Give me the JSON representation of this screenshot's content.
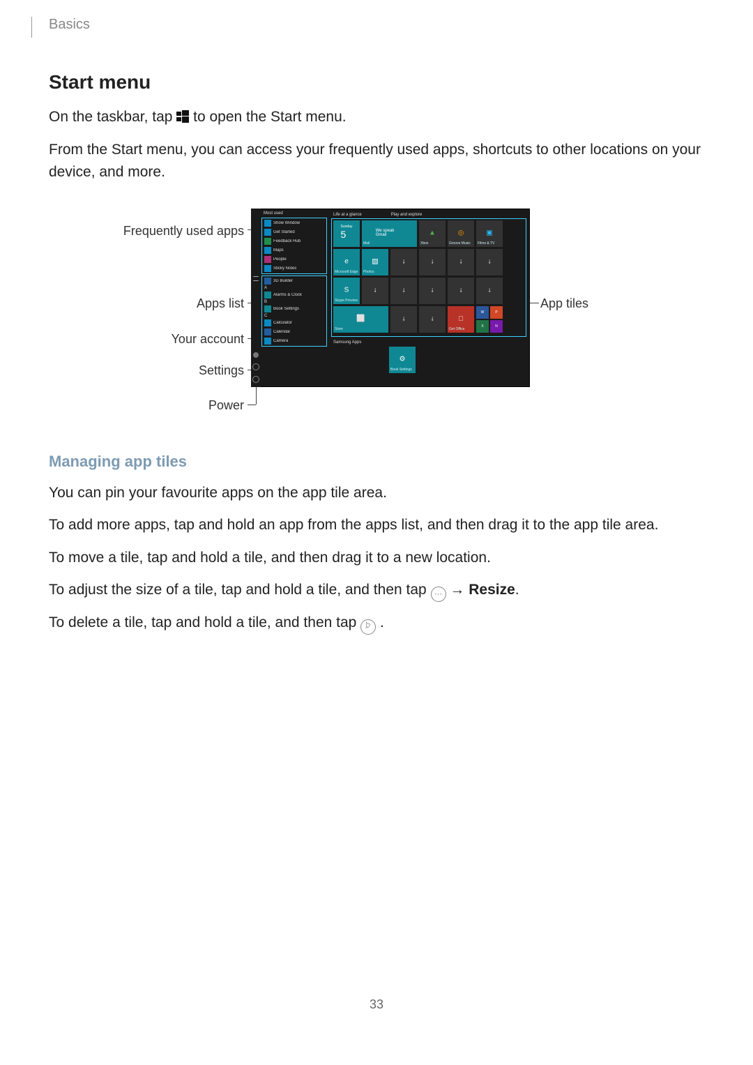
{
  "breadcrumb": "Basics",
  "section_title": "Start menu",
  "intro_1a": "On the taskbar, tap ",
  "intro_1b": " to open the Start menu.",
  "intro_2": "From the Start menu, you can access your frequently used apps, shortcuts to other locations on your device, and more.",
  "callouts": {
    "frequently_used": "Frequently used apps",
    "apps_list": "Apps list",
    "your_account": "Your account",
    "settings": "Settings",
    "power": "Power",
    "app_tiles": "App tiles"
  },
  "screenshot": {
    "most_used_header": "Most used",
    "most_used_items": [
      "Show Window",
      "Get Started",
      "Feedback Hub",
      "Maps",
      "People",
      "Sticky Notes"
    ],
    "alpha_groups": [
      {
        "letter": "#",
        "items": [
          "3D Builder"
        ]
      },
      {
        "letter": "A",
        "items": [
          "Alarms & Clock"
        ]
      },
      {
        "letter": "B",
        "items": [
          "Book Settings"
        ]
      },
      {
        "letter": "C",
        "items": [
          "Calculator",
          "Calendar",
          "Camera"
        ]
      }
    ],
    "tile_section_1": "Life at a glance",
    "tile_section_2": "Play and explore",
    "tile_section_3": "Samsung Apps",
    "tiles": {
      "calendar_day": "Sunday",
      "calendar_num": "5",
      "mail": "Mail",
      "mail_text": "We speak Gmail",
      "edge": "Microsoft Edge",
      "photos": "Photos",
      "skype": "Skype Preview",
      "store": "Store",
      "xbox": "Xbox",
      "groove": "Groove Music",
      "films": "Films & TV",
      "office": "Get Office",
      "book_settings": "Book Settings",
      "w": "W",
      "p": "P",
      "x": "X",
      "n": "N"
    }
  },
  "subsection_title": "Managing app tiles",
  "managing_1": "You can pin your favourite apps on the app tile area.",
  "managing_2": "To add more apps, tap and hold an app from the apps list, and then drag it to the app tile area.",
  "managing_3": "To move a tile, tap and hold a tile, and then drag it to a new location.",
  "managing_4a": "To adjust the size of a tile, tap and hold a tile, and then tap ",
  "managing_4b": " → ",
  "managing_4c": "Resize",
  "managing_4d": ".",
  "managing_5a": "To delete a tile, tap and hold a tile, and then tap ",
  "managing_5b": ".",
  "page_number": "33"
}
